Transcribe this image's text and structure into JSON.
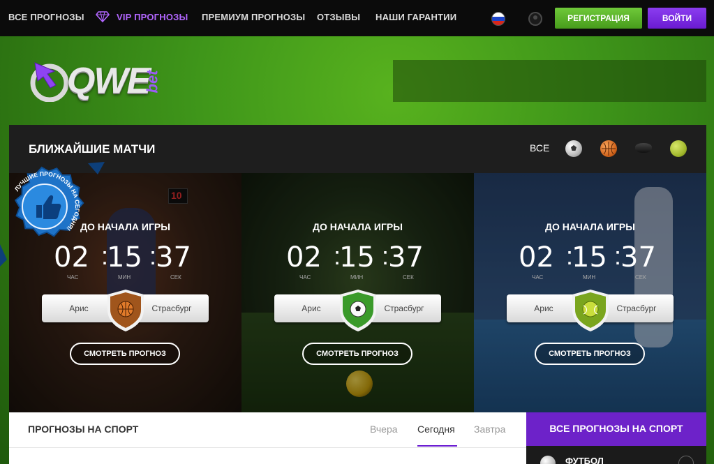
{
  "nav": {
    "items": [
      "ВСЕ ПРОГНОЗЫ",
      "VIP ПРОГНОЗЫ",
      "ПРЕМИУМ ПРОГНОЗЫ",
      "ОТЗЫВЫ",
      "НАШИ ГАРАНТИИ"
    ],
    "register": "РЕГИСТРАЦИЯ",
    "login": "ВОЙТИ"
  },
  "logo": {
    "main": "QWE",
    "sub": "bet"
  },
  "matches": {
    "title": "БЛИЖАЙШИЕ МАТЧИ",
    "filter_all": "ВСЕ",
    "badge_text": "ЛУЧШИЕ ПРОГНОЗЫ НА СЕГОДНЯ!",
    "cards": [
      {
        "label": "ДО НАЧАЛА ИГРЫ",
        "hours": "02",
        "minutes": "15",
        "seconds": "37",
        "unit_h": "ЧАС",
        "unit_m": "МИН",
        "unit_s": "СЕК",
        "team1": "Арис",
        "team2": "Страсбург",
        "sport_icon": "basketball-icon",
        "button": "СМОТРЕТЬ ПРОГНОЗ"
      },
      {
        "label": "ДО НАЧАЛА ИГРЫ",
        "hours": "02",
        "minutes": "15",
        "seconds": "37",
        "unit_h": "ЧАС",
        "unit_m": "МИН",
        "unit_s": "СЕК",
        "team1": "Арис",
        "team2": "Страсбург",
        "sport_icon": "football-icon",
        "button": "СМОТРЕТЬ ПРОГНОЗ"
      },
      {
        "label": "ДО НАЧАЛА ИГРЫ",
        "hours": "02",
        "minutes": "15",
        "seconds": "37",
        "unit_h": "ЧАС",
        "unit_m": "МИН",
        "unit_s": "СЕК",
        "team1": "Арис",
        "team2": "Страсбург",
        "sport_icon": "tennis-icon",
        "button": "СМОТРЕТЬ ПРОГНОЗ"
      }
    ]
  },
  "forecasts": {
    "title": "ПРОГНОЗЫ НА СПОРТ",
    "tabs": [
      "Вчера",
      "Сегодня",
      "Завтра"
    ],
    "active_tab": "Сегодня"
  },
  "sidebar": {
    "header": "ВСЕ ПРОГНОЗЫ НА СПОРТ",
    "first_item": "ФУТБОЛ"
  },
  "colors": {
    "accent": "#6d22c9",
    "register": "#5bb52b",
    "vip": "#b266ff"
  }
}
